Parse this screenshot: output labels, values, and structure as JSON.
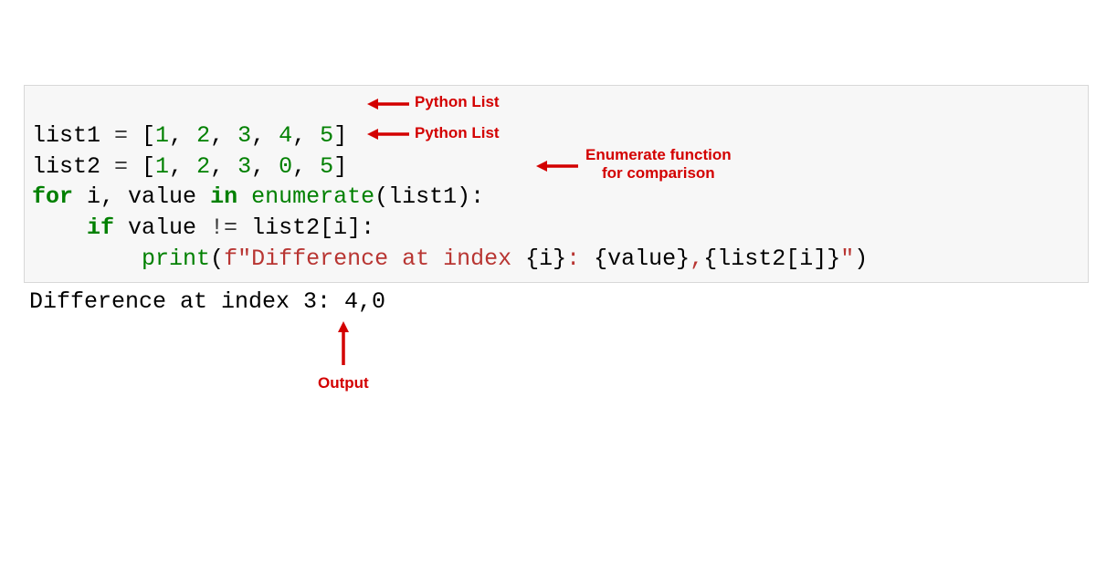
{
  "colors": {
    "annotation": "#d30000",
    "keyword": "#008000",
    "number": "#008000",
    "string": "#b83532"
  },
  "code": {
    "line1": {
      "var": "list1",
      "eq": " = ",
      "lb": "[",
      "n1": "1",
      "c1": ", ",
      "n2": "2",
      "c2": ", ",
      "n3": "3",
      "c3": ", ",
      "n4": "4",
      "c4": ", ",
      "n5": "5",
      "rb": "]"
    },
    "line2": {
      "var": "list2",
      "eq": " = ",
      "lb": "[",
      "n1": "1",
      "c1": ", ",
      "n2": "2",
      "c2": ", ",
      "n3": "3",
      "c3": ", ",
      "n4": "0",
      "c4": ", ",
      "n5": "5",
      "rb": "]"
    },
    "line3": {
      "for": "for ",
      "i": "i",
      "comma": ", ",
      "value": "value",
      "in": " in ",
      "enumerate": "enumerate",
      "call": "(list1):"
    },
    "line4": {
      "indent": "    ",
      "if": "if ",
      "value": "value",
      "neq": " != ",
      "rest": "list2[i]:"
    },
    "line5": {
      "indent": "        ",
      "print": "print",
      "open": "(",
      "fprefix": "f\"",
      "s1": "Difference at index ",
      "interp1": "{i}",
      "s2": ": ",
      "interp2": "{value}",
      "s3": ",",
      "interp3": "{list2[i]}",
      "closeq": "\"",
      "close": ")"
    }
  },
  "output": "Difference at index 3: 4,0",
  "annotations": {
    "list1": "Python List",
    "list2": "Python List",
    "enumerate": "Enumerate function\nfor comparison",
    "output": "Output"
  }
}
